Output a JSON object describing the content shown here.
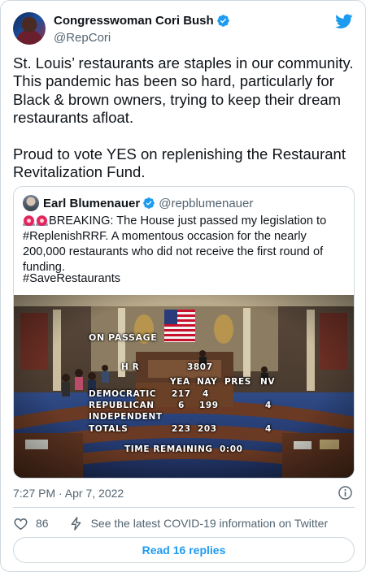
{
  "tweet": {
    "display_name": "Congresswoman Cori Bush",
    "handle": "@RepCori",
    "text": "St. Louis’ restaurants are staples in our community. This pandemic has been so hard, particularly for Black & brown owners, trying to keep their dream restaurants afloat.\n\nProud to vote YES on replenishing the Restaurant Revitalization Fund.",
    "timestamp": "7:27 PM · Apr 7, 2022",
    "like_count": "86",
    "covid_link": "See the latest COVID-19 information on Twitter",
    "read_replies": "Read 16 replies"
  },
  "quote": {
    "display_name": "Earl Blumenauer",
    "handle": "@repblumenauer",
    "text": "BREAKING: The House just passed my legislation to #ReplenishRRF. A momentous occasion for the nearly 200,000 restaurants who did not receive the first round of funding.",
    "hashtag": "#SaveRestaurants",
    "vote_board": {
      "on_passage": "ON PASSAGE",
      "bill": "H R",
      "bill_number": "3807",
      "col_yea": "YEA",
      "col_nay": "NAY",
      "col_pres": "PRES",
      "col_nv": "NV",
      "democratic_label": "DEMOCRATIC",
      "democratic_yea": "217",
      "democratic_nay": "4",
      "republican_label": "REPUBLICAN",
      "republican_yea": "6",
      "republican_nay": "199",
      "republican_nv": "4",
      "independent_label": "INDEPENDENT",
      "totals_label": "TOTALS",
      "totals_yea": "223",
      "totals_nay": "203",
      "totals_nv": "4",
      "time_remaining_label": "TIME REMAINING",
      "time_remaining": "0:00"
    }
  },
  "colors": {
    "accent": "#1d9bf0",
    "verified": "#1d9bf0",
    "secondary_text": "#536471",
    "border": "#cfd9de"
  },
  "icons": [
    "twitter-logo-icon",
    "verified-badge-icon",
    "siren-icon",
    "info-icon",
    "heart-icon",
    "covid-lightning-icon"
  ]
}
